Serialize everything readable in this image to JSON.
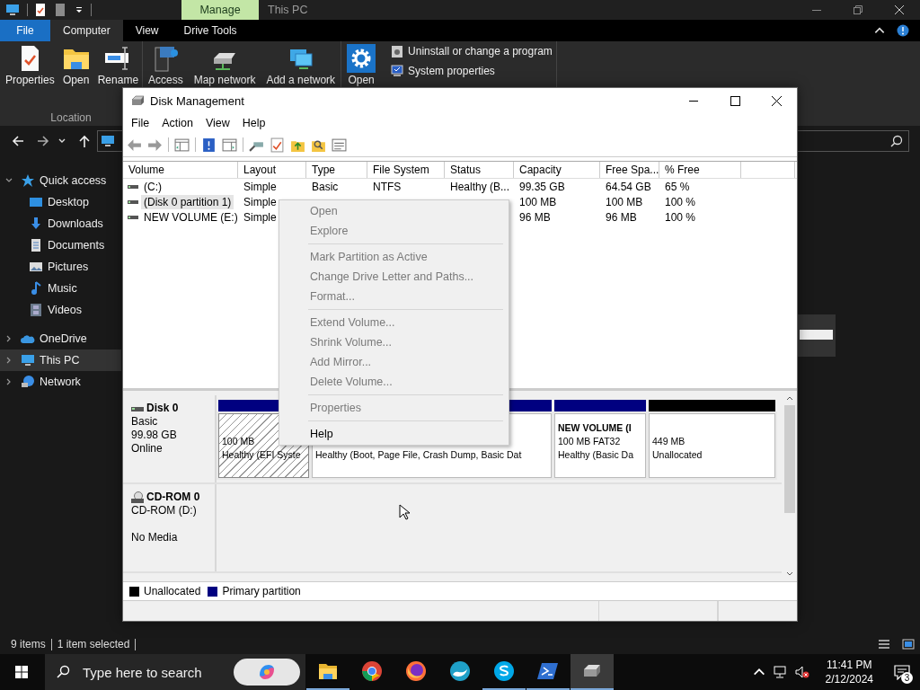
{
  "explorer": {
    "title_tabs": [
      {
        "label": "Manage",
        "kind": "context"
      },
      {
        "label": "This PC",
        "kind": "title"
      }
    ],
    "ribbon_tabs": [
      {
        "label": "File",
        "kind": "file",
        "selected": false
      },
      {
        "label": "Computer",
        "kind": "tab",
        "selected": true
      },
      {
        "label": "View",
        "kind": "tab",
        "selected": false
      },
      {
        "label": "Drive Tools",
        "kind": "tab",
        "selected": false
      }
    ],
    "ribbon_groups": [
      {
        "label": "Location",
        "buttons": [
          {
            "label": "Properties",
            "kind": "properties"
          },
          {
            "label": "Open",
            "kind": "open"
          },
          {
            "label": "Rename",
            "kind": "rename"
          }
        ]
      },
      {
        "buttons": [
          {
            "label": "Access",
            "kind": "media"
          },
          {
            "label": "Map network",
            "kind": "drive"
          },
          {
            "label": "Add a network",
            "kind": "network"
          }
        ]
      },
      {
        "buttons": [
          {
            "label": "Open",
            "kind": "settings"
          }
        ],
        "small_buttons": [
          {
            "label": "Uninstall or change a program",
            "kind": "uninstall"
          },
          {
            "label": "System properties",
            "kind": "system"
          }
        ]
      }
    ],
    "navigation": [
      {
        "label": "Quick access",
        "kind": "star",
        "expanded": true,
        "selected": false,
        "children": [
          {
            "label": "Desktop",
            "kind": "desktop",
            "selected": false
          },
          {
            "label": "Downloads",
            "kind": "downloads",
            "selected": false
          },
          {
            "label": "Documents",
            "kind": "documents",
            "selected": false
          },
          {
            "label": "Pictures",
            "kind": "pictures",
            "selected": false
          },
          {
            "label": "Music",
            "kind": "music",
            "selected": false
          },
          {
            "label": "Videos",
            "kind": "videos",
            "selected": false
          }
        ]
      },
      {
        "label": "OneDrive",
        "kind": "cloud",
        "expanded": false,
        "selected": false
      },
      {
        "label": "This PC",
        "kind": "pc",
        "expanded": false,
        "selected": true
      },
      {
        "label": "Network",
        "kind": "network",
        "expanded": false,
        "selected": false
      }
    ],
    "status_bar": {
      "items": "9 items",
      "selection": "1 item selected"
    }
  },
  "disk_management": {
    "title": "Disk Management",
    "menu": [
      "File",
      "Action",
      "View",
      "Help"
    ],
    "columns": [
      "Volume",
      "Layout",
      "Type",
      "File System",
      "Status",
      "Capacity",
      "Free Spa...",
      "% Free"
    ],
    "volumes": [
      {
        "volume": "(C:)",
        "layout": "Simple",
        "type": "Basic",
        "file_system": "NTFS",
        "status": "Healthy (B...",
        "capacity": "99.35 GB",
        "free_space": "64.54 GB",
        "percent_free": "65 %",
        "selected": false
      },
      {
        "volume": "(Disk 0 partition 1)",
        "layout": "Simple",
        "capacity": "100 MB",
        "free_space": "100 MB",
        "percent_free": "100 %",
        "selected": true
      },
      {
        "volume": "NEW VOLUME (E:)",
        "layout": "Simple",
        "capacity": "96 MB",
        "free_space": "96 MB",
        "percent_free": "100 %",
        "selected": false
      }
    ],
    "disks": [
      {
        "name": "Disk 0",
        "kind": "disk",
        "type": "Basic",
        "size": "99.98 GB",
        "state": "Online",
        "partitions": [
          {
            "kind": "primary",
            "size": "100 MB",
            "status": "Healthy (EFI Syste",
            "selected": true
          },
          {
            "kind": "primary",
            "status": "Healthy (Boot, Page File, Crash Dump, Basic Dat",
            "selected": false
          },
          {
            "kind": "primary",
            "name": "NEW VOLUME  (I",
            "size": "100 MB FAT32",
            "status": "Healthy (Basic Da",
            "selected": false
          },
          {
            "kind": "unallocated",
            "size": "449 MB",
            "status": "Unallocated",
            "selected": false
          }
        ]
      },
      {
        "name": "CD-ROM 0",
        "kind": "cdrom",
        "type": "CD-ROM (D:)",
        "state": "No Media"
      }
    ],
    "legend": [
      {
        "label": "Unallocated",
        "color": "#000000"
      },
      {
        "label": "Primary partition",
        "color": "#000080"
      }
    ]
  },
  "context_menu": [
    {
      "kind": "item",
      "label": "Open",
      "disabled": true
    },
    {
      "kind": "item",
      "label": "Explore",
      "disabled": true
    },
    {
      "kind": "separator"
    },
    {
      "kind": "item",
      "label": "Mark Partition as Active",
      "disabled": true
    },
    {
      "kind": "item",
      "label": "Change Drive Letter and Paths...",
      "disabled": true
    },
    {
      "kind": "item",
      "label": "Format...",
      "disabled": true
    },
    {
      "kind": "separator"
    },
    {
      "kind": "item",
      "label": "Extend Volume...",
      "disabled": true
    },
    {
      "kind": "item",
      "label": "Shrink Volume...",
      "disabled": true
    },
    {
      "kind": "item",
      "label": "Add Mirror...",
      "disabled": true
    },
    {
      "kind": "item",
      "label": "Delete Volume...",
      "disabled": true
    },
    {
      "kind": "separator"
    },
    {
      "kind": "item",
      "label": "Properties",
      "disabled": true
    },
    {
      "kind": "separator"
    },
    {
      "kind": "item",
      "label": "Help",
      "disabled": false
    }
  ],
  "taskbar": {
    "search_placeholder": "Type here to search",
    "apps": [
      {
        "kind": "folder",
        "running": true,
        "selected": false
      },
      {
        "kind": "chrome",
        "running": false,
        "selected": false
      },
      {
        "kind": "firefox",
        "running": false,
        "selected": false
      },
      {
        "kind": "wave",
        "running": false,
        "selected": false
      },
      {
        "kind": "skype",
        "running": true,
        "selected": false
      },
      {
        "kind": "terminal",
        "running": true,
        "selected": false
      },
      {
        "kind": "disk",
        "running": true,
        "selected": true
      }
    ],
    "time": "11:41 PM",
    "date": "2/12/2024",
    "notification_count": "3"
  }
}
